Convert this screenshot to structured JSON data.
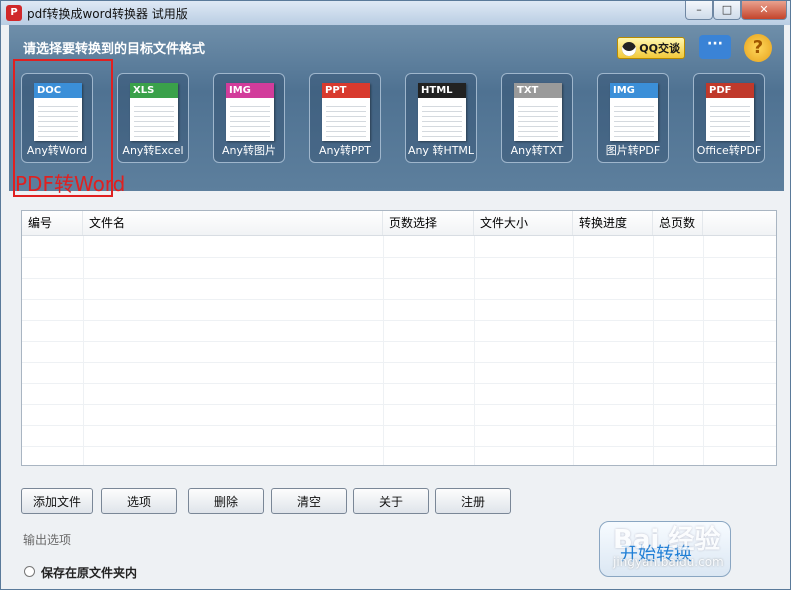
{
  "window": {
    "title": "pdf转换成word转换器 试用版",
    "controls": {
      "minimize": "–",
      "maximize": "□",
      "close": "✕"
    }
  },
  "banner": {
    "title": "请选择要转换到的目标文件格式",
    "qq_badge": "QQ交谈",
    "tiles": [
      {
        "tag": "DOC",
        "label": "Any转Word",
        "color": "#3b8fd8"
      },
      {
        "tag": "XLS",
        "label": "Any转Excel",
        "color": "#3aa14a"
      },
      {
        "tag": "IMG",
        "label": "Any转图片",
        "color": "#d23c9b"
      },
      {
        "tag": "PPT",
        "label": "Any转PPT",
        "color": "#d83a2e"
      },
      {
        "tag": "HTML",
        "label": "Any 转HTML",
        "color": "#222222"
      },
      {
        "tag": "TXT",
        "label": "Any转TXT",
        "color": "#9a9a9a"
      },
      {
        "tag": "IMG",
        "label": "图片转PDF",
        "color": "#3b8fd8"
      },
      {
        "tag": "PDF",
        "label": "Office转PDF",
        "color": "#c0392b"
      }
    ],
    "annotation": "PDF转Word"
  },
  "grid": {
    "columns": [
      "编号",
      "文件名",
      "页数选择",
      "文件大小",
      "转换进度",
      "总页数"
    ],
    "rows": []
  },
  "buttons": {
    "add_file": "添加文件",
    "options": "选项",
    "delete": "删除",
    "clear": "清空",
    "about": "关于",
    "register": "注册"
  },
  "output": {
    "section_label": "输出选项",
    "save_in_original": "保存在原文件夹内"
  },
  "start_button": "开始转换",
  "watermark": {
    "brand": "Bai 经验",
    "url": "jingyan.baidu.com"
  }
}
